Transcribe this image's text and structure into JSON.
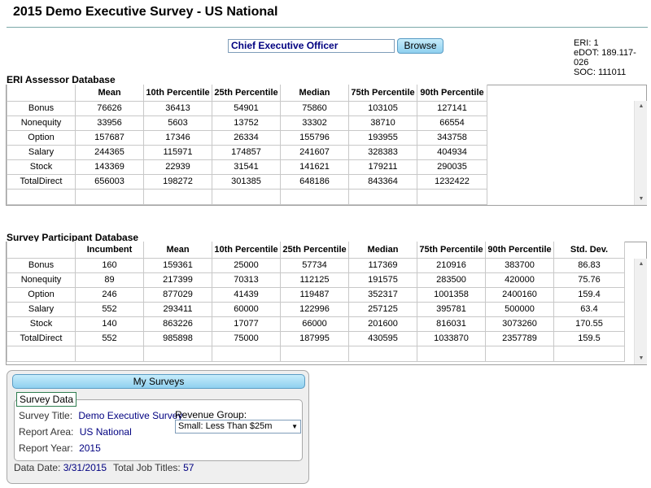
{
  "header": {
    "title": "2015 Demo Executive Survey - US National",
    "job_input_value": "Chief Executive Officer",
    "browse_label": "Browse",
    "eri": "ERI: 1",
    "edot": "eDOT: 189.117-026",
    "soc": "SOC: 111011"
  },
  "assessor": {
    "label": "ERI Assessor Database",
    "columns": [
      "",
      "Mean",
      "10th Percentile",
      "25th Percentile",
      "Median",
      "75th Percentile",
      "90th Percentile"
    ],
    "rows": [
      [
        "Bonus",
        "76626",
        "36413",
        "54901",
        "75860",
        "103105",
        "127141"
      ],
      [
        "Nonequity",
        "33956",
        "5603",
        "13752",
        "33302",
        "38710",
        "66554"
      ],
      [
        "Option",
        "157687",
        "17346",
        "26334",
        "155796",
        "193955",
        "343758"
      ],
      [
        "Salary",
        "244365",
        "115971",
        "174857",
        "241607",
        "328383",
        "404934"
      ],
      [
        "Stock",
        "143369",
        "22939",
        "31541",
        "141621",
        "179211",
        "290035"
      ],
      [
        "TotalDirect",
        "656003",
        "198272",
        "301385",
        "648186",
        "843364",
        "1232422"
      ]
    ]
  },
  "participant": {
    "label": "Survey Participant Database",
    "columns": [
      "",
      "Incumbent",
      "Mean",
      "10th Percentile",
      "25th Percentile",
      "Median",
      "75th Percentile",
      "90th Percentile",
      "Std. Dev."
    ],
    "rows": [
      [
        "Bonus",
        "160",
        "159361",
        "25000",
        "57734",
        "117369",
        "210916",
        "383700",
        "86.83"
      ],
      [
        "Nonequity",
        "89",
        "217399",
        "70313",
        "112125",
        "191575",
        "283500",
        "420000",
        "75.76"
      ],
      [
        "Option",
        "246",
        "877029",
        "41439",
        "119487",
        "352317",
        "1001358",
        "2400160",
        "159.4"
      ],
      [
        "Salary",
        "552",
        "293411",
        "60000",
        "122996",
        "257125",
        "395781",
        "500000",
        "63.4"
      ],
      [
        "Stock",
        "140",
        "863226",
        "17077",
        "66000",
        "201600",
        "816031",
        "3073260",
        "170.55"
      ],
      [
        "TotalDirect",
        "552",
        "985898",
        "75000",
        "187995",
        "430595",
        "1033870",
        "2357789",
        "159.5"
      ]
    ]
  },
  "surveys": {
    "button_label": "My Surveys",
    "legend": "Survey Data",
    "survey_title_label": "Survey Title:",
    "survey_title_value": "Demo Executive Survey",
    "report_area_label": "Report Area:",
    "report_area_value": "US National",
    "report_year_label": "Report Year:",
    "report_year_value": "2015",
    "revenue_label": "Revenue Group:",
    "revenue_value": "Small: Less Than $25m",
    "data_date_label": "Data Date:",
    "data_date_value": "3/31/2015",
    "job_titles_label": "Total Job Titles:",
    "job_titles_value": "57"
  },
  "icons": {
    "scroll_up": "scroll-up-arrow",
    "scroll_down": "scroll-down-arrow",
    "dropdown": "chevron-down"
  },
  "colors": {
    "accent_button": "#8fd0ef",
    "link_value": "#000080",
    "legend_border": "#2e7d4f"
  }
}
